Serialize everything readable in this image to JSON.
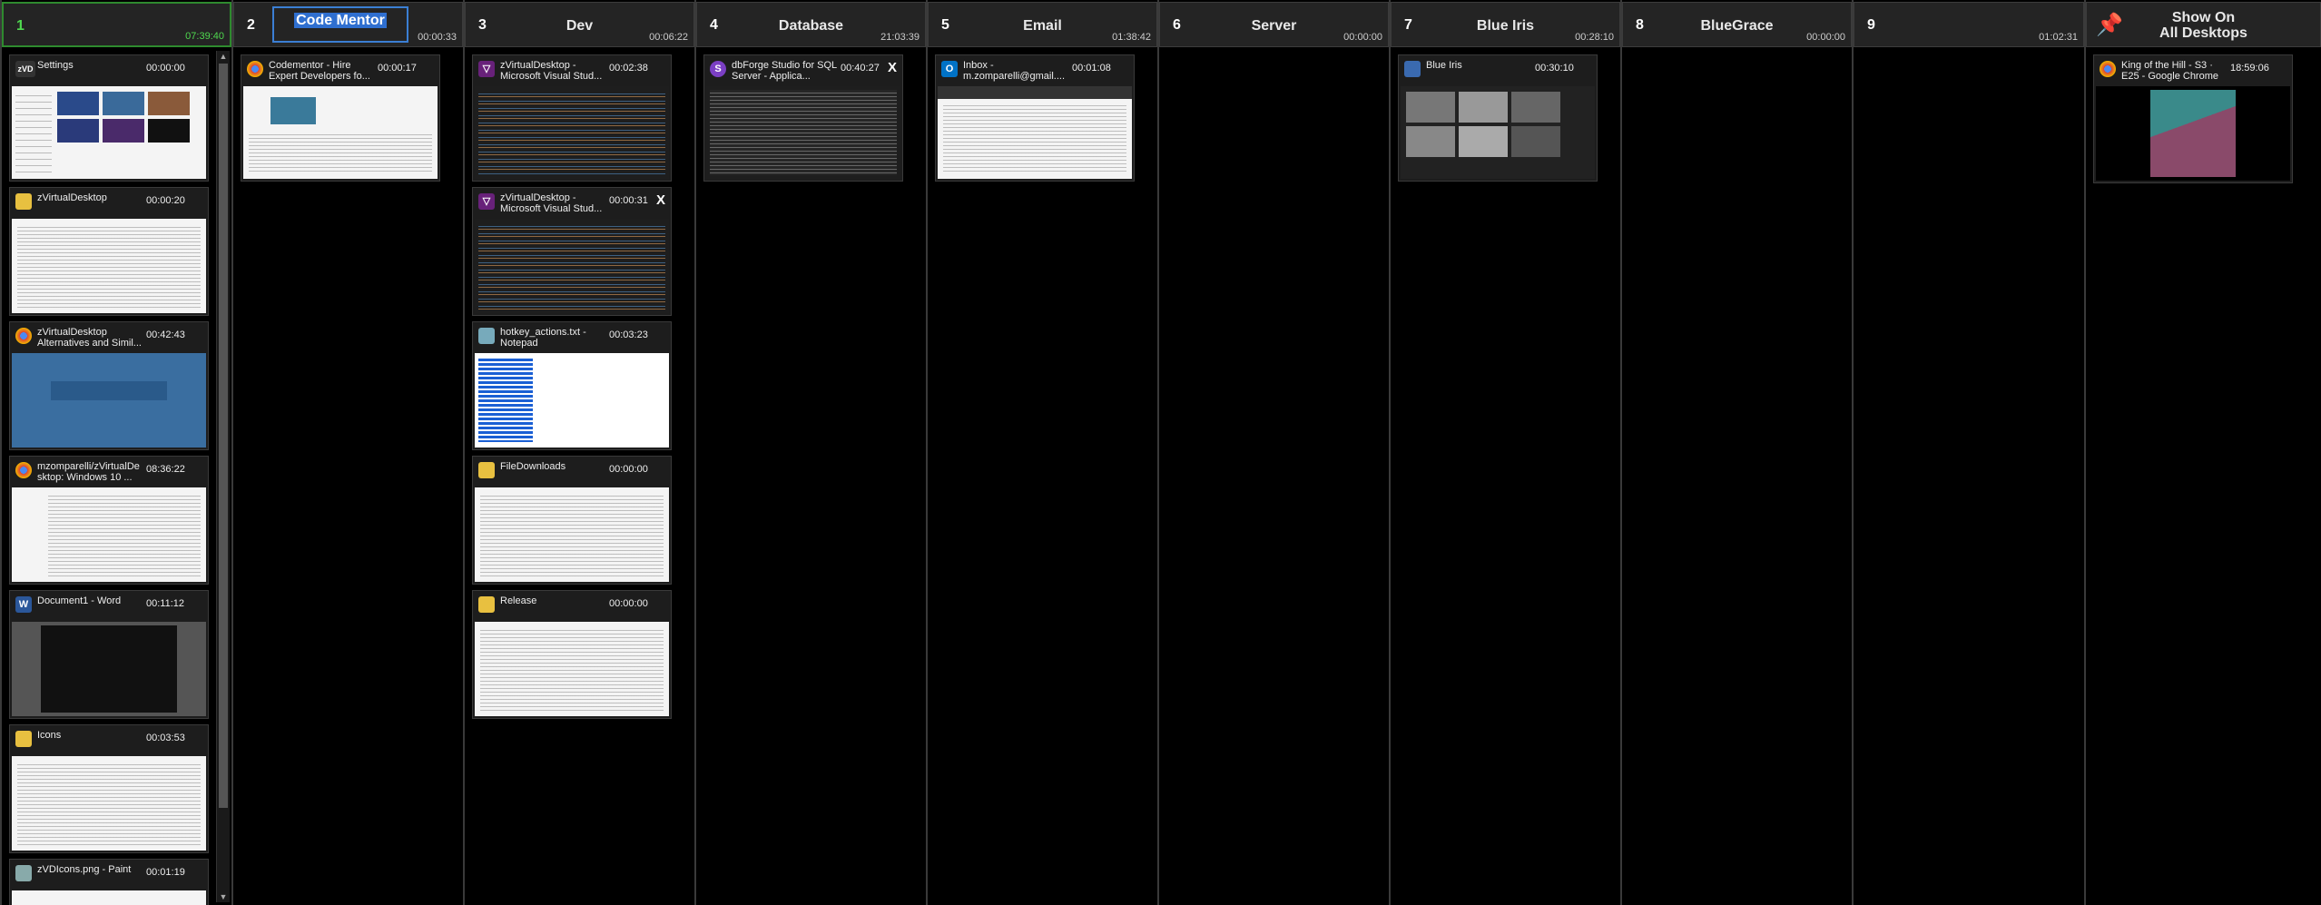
{
  "desktops": [
    {
      "num": "1",
      "name": "",
      "time": "07:39:40"
    },
    {
      "num": "2",
      "name": "Code Mentor",
      "time": "00:00:33"
    },
    {
      "num": "3",
      "name": "Dev",
      "time": "00:06:22"
    },
    {
      "num": "4",
      "name": "Database",
      "time": "21:03:39"
    },
    {
      "num": "5",
      "name": "Email",
      "time": "01:38:42"
    },
    {
      "num": "6",
      "name": "Server",
      "time": "00:00:00"
    },
    {
      "num": "7",
      "name": "Blue Iris",
      "time": "00:28:10"
    },
    {
      "num": "8",
      "name": "BlueGrace",
      "time": "00:00:00"
    },
    {
      "num": "9",
      "name": "",
      "time": "01:02:31"
    },
    {
      "num": "",
      "name": "Show On\nAll Desktops",
      "time": ""
    }
  ],
  "windows": {
    "d1": [
      {
        "title": "Settings",
        "time": "00:00:00",
        "icon": "zVD"
      },
      {
        "title": "zVirtualDesktop",
        "time": "00:00:20",
        "icon": "folder"
      },
      {
        "title": "zVirtualDesktop Alternatives and Simil...",
        "time": "00:42:43",
        "icon": "chrome"
      },
      {
        "title": "mzomparelli/zVirtualDe sktop: Windows 10 ...",
        "time": "08:36:22",
        "icon": "chrome"
      },
      {
        "title": "Document1 - Word",
        "time": "00:11:12",
        "icon": "word"
      },
      {
        "title": "Icons",
        "time": "00:03:53",
        "icon": "folder"
      },
      {
        "title": "zVDIcons.png - Paint",
        "time": "00:01:19",
        "icon": "paint"
      }
    ],
    "d2": [
      {
        "title": "Codementor - Hire Expert Developers fo...",
        "time": "00:00:17",
        "icon": "chrome"
      }
    ],
    "d3": [
      {
        "title": "zVirtualDesktop - Microsoft Visual Stud...",
        "time": "00:02:38",
        "icon": "vs"
      },
      {
        "title": "zVirtualDesktop - Microsoft Visual Stud...",
        "time": "00:00:31",
        "icon": "vs",
        "close": "X"
      },
      {
        "title": "hotkey_actions.txt - Notepad",
        "time": "00:03:23",
        "icon": "notepad"
      },
      {
        "title": "FileDownloads",
        "time": "00:00:00",
        "icon": "folder"
      },
      {
        "title": "Release",
        "time": "00:00:00",
        "icon": "folder"
      }
    ],
    "d4": [
      {
        "title": "dbForge Studio for SQL Server - Applica...",
        "time": "00:40:27",
        "icon": "dbforge",
        "close": "X"
      }
    ],
    "d5": [
      {
        "title": "Inbox - m.zomparelli@gmail....",
        "time": "00:01:08",
        "icon": "outlook"
      }
    ],
    "d7": [
      {
        "title": "Blue Iris",
        "time": "00:30:10",
        "icon": "blueiris"
      }
    ],
    "pinned": [
      {
        "title": "King of the Hill - S3 · E25 - Google Chrome",
        "time": "18:59:06",
        "icon": "chrome"
      }
    ]
  },
  "colors": {
    "active_border": "#2e8a2e",
    "active_time": "#4fd84f",
    "rename_highlight": "#2f6fd0"
  }
}
